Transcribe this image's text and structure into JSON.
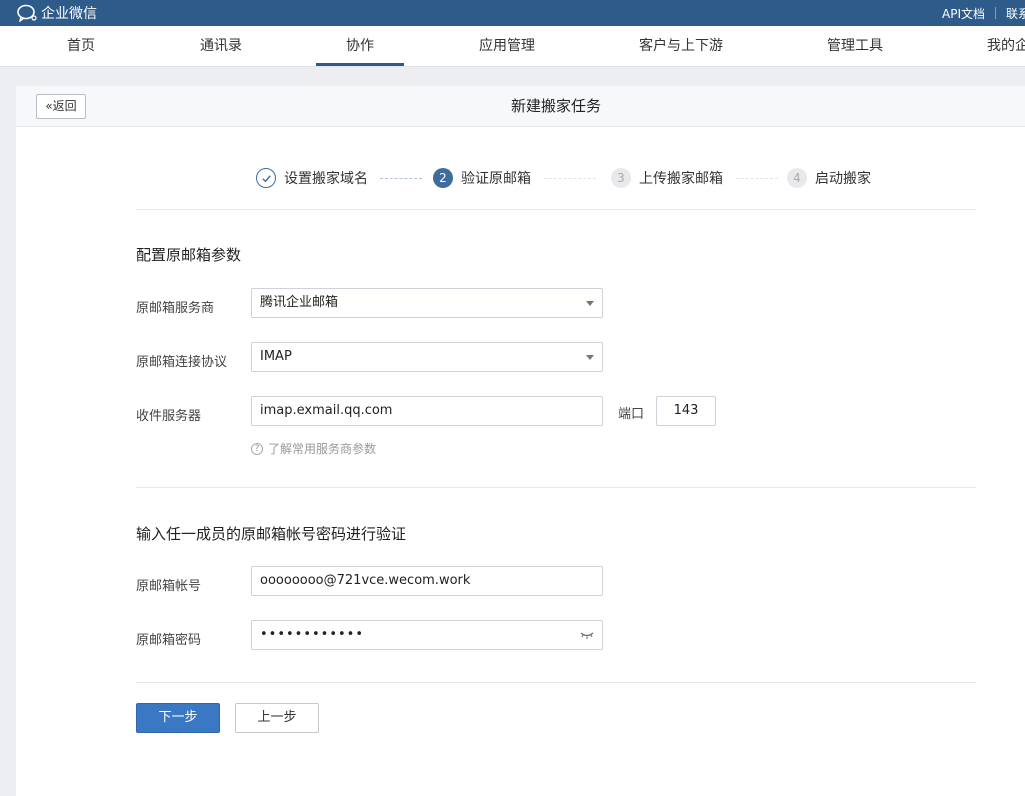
{
  "topbar": {
    "logo_text": "企业微信",
    "links": [
      "API文档",
      "联系"
    ]
  },
  "nav": {
    "items": [
      "首页",
      "通讯录",
      "协作",
      "应用管理",
      "客户与上下游",
      "管理工具",
      "我的企"
    ],
    "active": "协作"
  },
  "panel": {
    "back_label": "返回",
    "title": "新建搬家任务"
  },
  "steps": [
    {
      "num": "1",
      "label": "设置搬家域名",
      "state": "done"
    },
    {
      "num": "2",
      "label": "验证原邮箱",
      "state": "current"
    },
    {
      "num": "3",
      "label": "上传搬家邮箱",
      "state": "pending"
    },
    {
      "num": "4",
      "label": "启动搬家",
      "state": "pending"
    }
  ],
  "config": {
    "title": "配置原邮箱参数",
    "provider_label": "原邮箱服务商",
    "provider_value": "腾讯企业邮箱",
    "protocol_label": "原邮箱连接协议",
    "protocol_value": "IMAP",
    "server_label": "收件服务器",
    "server_value": "imap.exmail.qq.com",
    "port_label": "端口",
    "port_value": "143",
    "help_text": "了解常用服务商参数",
    "help_icon": "question-circle-icon"
  },
  "verify": {
    "title": "输入任一成员的原邮箱帐号密码进行验证",
    "account_label": "原邮箱帐号",
    "account_value": "oooooooo@721vce.wecom.work",
    "password_label": "原邮箱密码",
    "password_value": "••••••••••••"
  },
  "actions": {
    "next_label": "下一步",
    "prev_label": "上一步"
  },
  "colors": {
    "topbar": "#2f5b8b",
    "primary": "#3a78c3",
    "step_active": "#3e6d9d"
  }
}
